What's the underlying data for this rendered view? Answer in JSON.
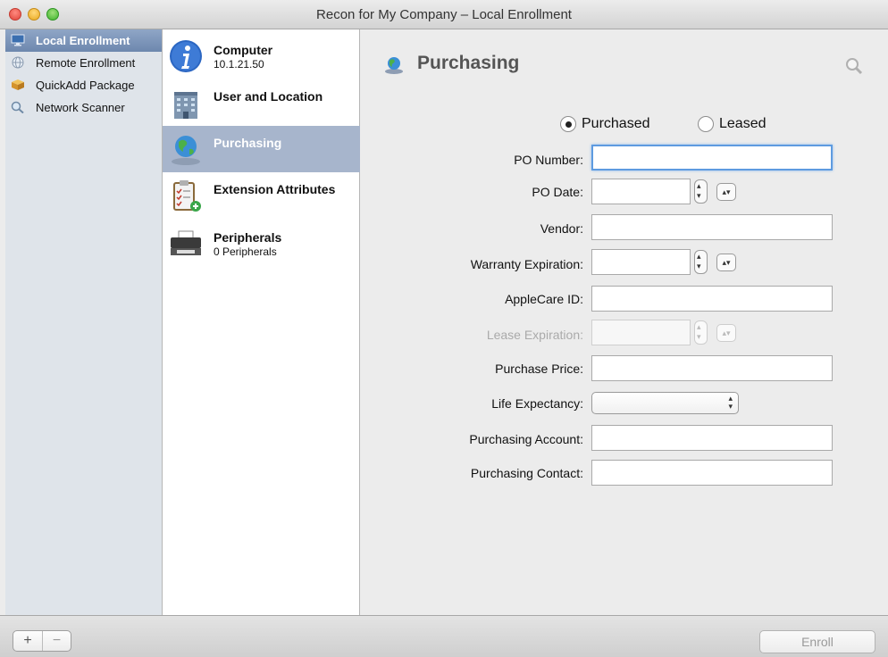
{
  "window": {
    "title": "Recon for My Company – Local Enrollment"
  },
  "sidebar": {
    "items": [
      {
        "label": "Local Enrollment",
        "icon": "monitor-icon",
        "selected": true
      },
      {
        "label": "Remote Enrollment",
        "icon": "globe-icon",
        "selected": false
      },
      {
        "label": "QuickAdd Package",
        "icon": "package-icon",
        "selected": false
      },
      {
        "label": "Network Scanner",
        "icon": "magnifier-icon",
        "selected": false
      }
    ]
  },
  "categories": {
    "items": [
      {
        "title": "Computer",
        "subtitle": "10.1.21.50",
        "icon": "info-icon"
      },
      {
        "title": "User and Location",
        "subtitle": "",
        "icon": "building-icon"
      },
      {
        "title": "Purchasing",
        "subtitle": "",
        "icon": "globe-icon",
        "selected": true
      },
      {
        "title": "Extension Attributes",
        "subtitle": "",
        "icon": "clipboard-icon"
      },
      {
        "title": "Peripherals",
        "subtitle": "0 Peripherals",
        "icon": "printer-icon"
      }
    ]
  },
  "pane": {
    "title": "Purchasing",
    "radio": {
      "purchased": "Purchased",
      "leased": "Leased",
      "selected": "Purchased"
    },
    "fields": {
      "po_number": {
        "label": "PO Number:",
        "value": ""
      },
      "po_date": {
        "label": "PO Date:",
        "value": ""
      },
      "vendor": {
        "label": "Vendor:",
        "value": ""
      },
      "warranty_expiration": {
        "label": "Warranty Expiration:",
        "value": ""
      },
      "applecare_id": {
        "label": "AppleCare ID:",
        "value": ""
      },
      "lease_expiration": {
        "label": "Lease Expiration:",
        "value": "",
        "disabled": true
      },
      "purchase_price": {
        "label": "Purchase Price:",
        "value": ""
      },
      "life_expectancy": {
        "label": "Life Expectancy:",
        "value": ""
      },
      "purchasing_account": {
        "label": "Purchasing Account:",
        "value": ""
      },
      "purchasing_contact": {
        "label": "Purchasing Contact:",
        "value": ""
      }
    }
  },
  "toolbar": {
    "add_label": "+",
    "remove_label": "−",
    "enroll_label": "Enroll"
  }
}
